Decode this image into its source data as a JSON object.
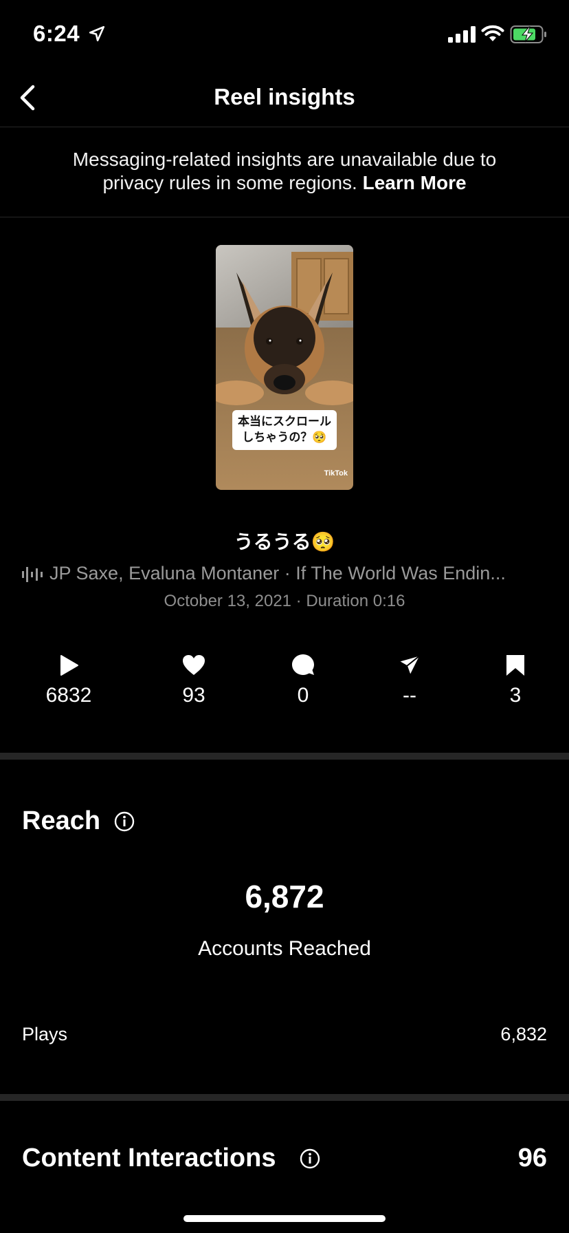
{
  "status_bar": {
    "time": "6:24"
  },
  "header": {
    "title": "Reel insights"
  },
  "notice": {
    "text": "Messaging-related insights are unavailable due to privacy rules in some regions.",
    "link": "Learn More"
  },
  "thumbnail": {
    "caption_line1": "本当にスクロール",
    "caption_line2": "しちゃうの？🥺",
    "watermark": "TikTok"
  },
  "reel": {
    "title": "うるうる🥺",
    "music": "JP Saxe, Evaluna Montaner · If The World Was Endin...",
    "date_duration": "October 13, 2021 · Duration 0:16"
  },
  "stats": {
    "plays": "6832",
    "likes": "93",
    "comments": "0",
    "shares": "--",
    "saves": "3"
  },
  "reach": {
    "title": "Reach",
    "accounts_value": "6,872",
    "accounts_label": "Accounts Reached",
    "plays_label": "Plays",
    "plays_value": "6,832"
  },
  "content_interactions": {
    "title": "Content Interactions",
    "value": "96"
  },
  "colors": {
    "background": "#000000",
    "divider": "#262626",
    "muted": "#8e8e8e",
    "battery": "#4cd964"
  }
}
